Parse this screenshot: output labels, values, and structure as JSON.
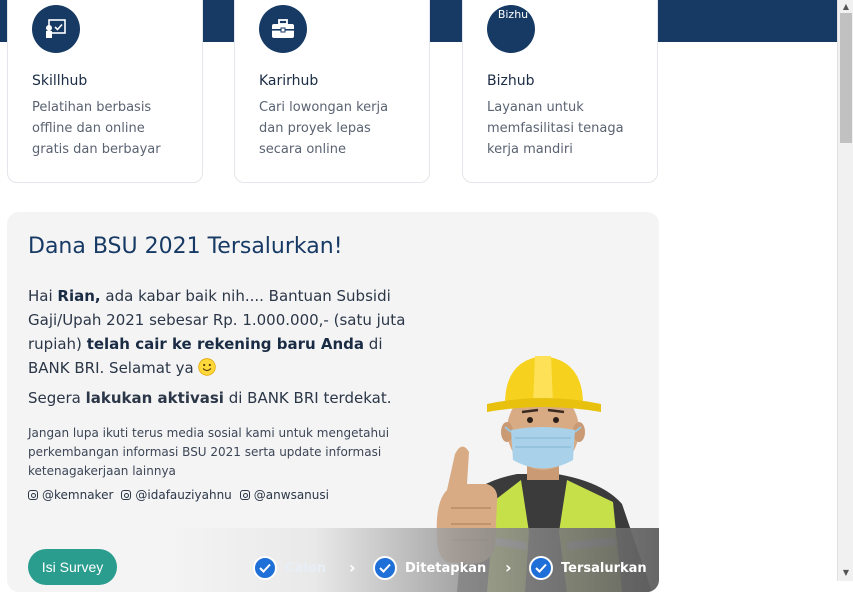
{
  "services": [
    {
      "title": "Skillhub",
      "desc": "Pelatihan berbasis offline dan online gratis dan berbayar",
      "icon": "certificate-icon"
    },
    {
      "title": "Karirhub",
      "desc": "Cari lowongan kerja dan proyek lepas secara online",
      "icon": "briefcase-icon"
    },
    {
      "title": "Bizhub",
      "desc": "Layanan untuk memfasilitasi tenaga kerja mandiri",
      "icon": "broken-image-icon",
      "alt": "Bizhu"
    }
  ],
  "bsu": {
    "title": "Dana BSU 2021 Tersalurkan!",
    "greet_prefix": "Hai ",
    "name": "Rian,",
    "msg_part1": " ada kabar baik nih.... Bantuan Subsidi Gaji/Upah 2021 sebesar Rp. 1.000.000,- (satu juta rupiah) ",
    "msg_bold": "telah cair ke rekening baru Anda",
    "msg_part2": " di BANK BRI. Selamat ya ",
    "msg2_prefix": "Segera ",
    "msg2_bold": "lakukan aktivasi",
    "msg2_suffix": " di BANK BRI terdekat.",
    "note": "Jangan lupa ikuti terus media sosial kami untuk mengetahui perkembangan informasi BSU 2021 serta update informasi ketenagakerjaan lainnya",
    "socials": [
      "@kemnaker",
      "@idafauziyahnu",
      "@anwsanusi"
    ],
    "survey_button": "Isi Survey",
    "steps": [
      "Calon",
      "Ditetapkan",
      "Tersalurkan"
    ]
  },
  "colors": {
    "navy": "#173a64",
    "teal": "#2a9d8f",
    "check_blue": "#1f6fd8"
  }
}
